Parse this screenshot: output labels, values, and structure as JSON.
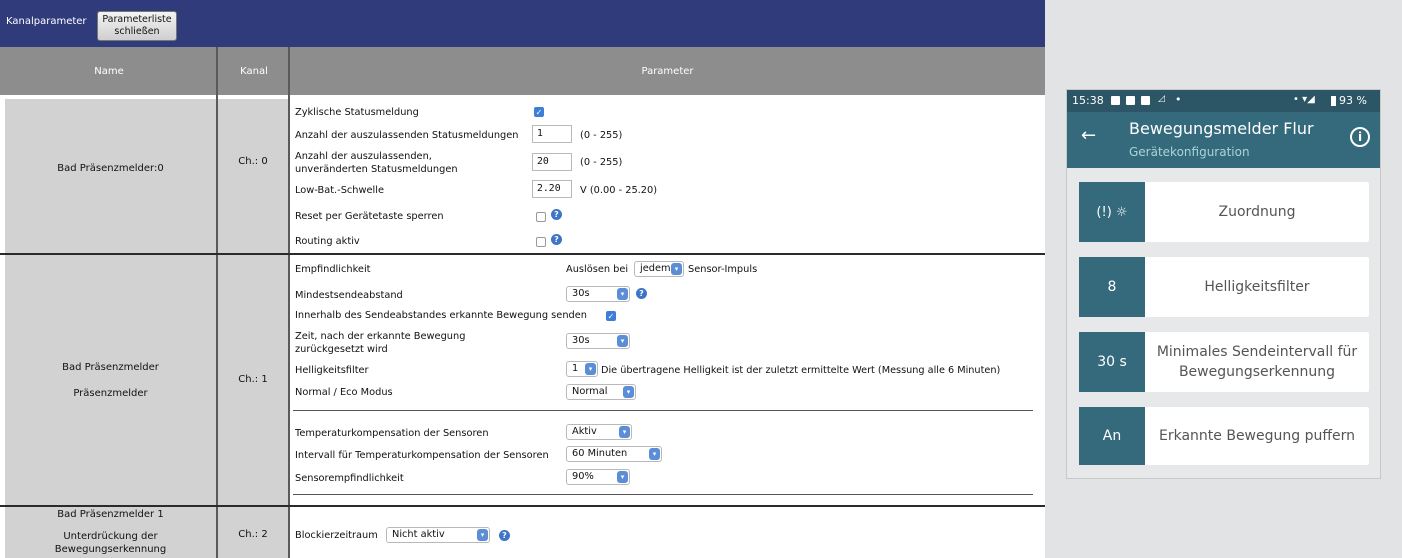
{
  "toolbar": {
    "title": "Kanalparameter",
    "close_button_line1": "Parameterliste",
    "close_button_line2": "schließen"
  },
  "table_header": {
    "name": "Name",
    "kanal": "Kanal",
    "parameter": "Parameter"
  },
  "rows": [
    {
      "name": "Bad Präsenzmelder:0",
      "kanal": "Ch.: 0",
      "params": {
        "zyklisch": "Zyklische Statusmeldung",
        "auszulassen": "Anzahl der auszulassenden Statusmeldungen",
        "auszulassen_value": "1",
        "auszulassen_range": "(0 - 255)",
        "unveraendert_1": "Anzahl der auszulassenden,",
        "unveraendert_2": "unveränderten Statusmeldungen",
        "unveraendert_value": "20",
        "unveraendert_range": "(0 - 255)",
        "lowbat": "Low-Bat.-Schwelle",
        "lowbat_value": "2.20",
        "lowbat_range": "V (0.00 - 25.20)",
        "reset": "Reset per Gerätetaste sperren",
        "routing": "Routing aktiv"
      }
    },
    {
      "name_1": "Bad Präsenzmelder",
      "name_2": "Präsenzmelder",
      "kanal": "Ch.: 1",
      "params": {
        "empf": "Empfindlichkeit",
        "empf_prefix": "Auslösen bei",
        "empf_value": "jedem",
        "empf_suffix": "Sensor-Impuls",
        "mindest": "Mindestsendeabstand",
        "mindest_value": "30s",
        "innerhalb": "Innerhalb des Sendeabstandes erkannte Bewegung senden",
        "zeit_1": "Zeit, nach der erkannte Bewegung",
        "zeit_2": "zurückgesetzt wird",
        "zeit_value": "30s",
        "hell": "Helligkeitsfilter",
        "hell_value": "1",
        "hell_note": "Die übertragene Helligkeit ist der zuletzt ermittelte Wert (Messung alle 6 Minuten)",
        "eco": "Normal / Eco Modus",
        "eco_value": "Normal",
        "temp": "Temperaturkompensation der Sensoren",
        "temp_value": "Aktiv",
        "intervall": "Intervall für Temperaturkompensation der Sensoren",
        "intervall_value": "60 Minuten",
        "sensor": "Sensorempfindlichkeit",
        "sensor_value": "90%"
      }
    },
    {
      "name_1": "Bad Präsenzmelder 1",
      "name_2": "Unterdrückung der",
      "name_3": "Bewegungserkennung",
      "kanal": "Ch.: 2",
      "params": {
        "block": "Blockierzeitraum",
        "block_value": "Nicht aktiv"
      }
    }
  ],
  "phone": {
    "status_time": "15:38",
    "status_battery": "93 %",
    "title": "Bewegungsmelder Flur",
    "subtitle": "Gerätekonfiguration",
    "cards": [
      {
        "badge": "",
        "label": "Zuordnung",
        "icon": "alert-brightness-icon"
      },
      {
        "badge": "8",
        "label": "Helligkeitsfilter"
      },
      {
        "badge": "30 s",
        "label_1": "Minimales Sendeintervall für",
        "label_2": "Bewegungserkennung"
      },
      {
        "badge": "An",
        "label": "Erkannte Bewegung puffern"
      }
    ]
  },
  "colors": {
    "topbar": "#303b7c",
    "table_header": "#8d8d8d",
    "app_accent": "#346a7b",
    "checkbox": "#3d7fd6"
  }
}
